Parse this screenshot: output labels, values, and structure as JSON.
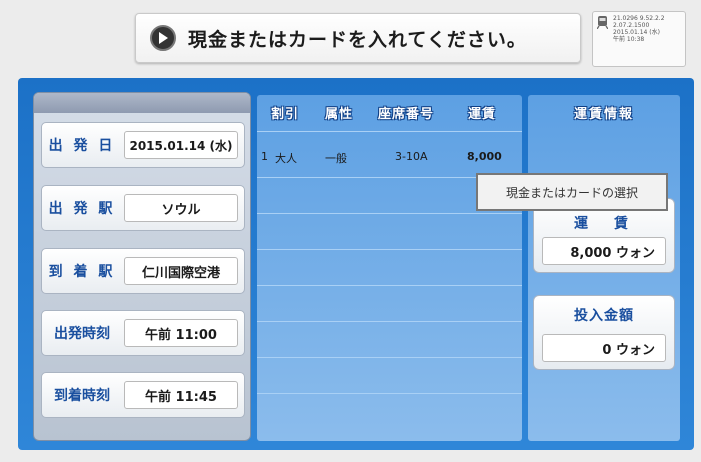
{
  "banner": {
    "text": "現金またはカードを入れてください。"
  },
  "ticket_info": {
    "lines": [
      "21.0296 9.52.2.2",
      "2.07.2.1500",
      "2015.01.14 (水)",
      "午前 10:38"
    ]
  },
  "left": {
    "fields": [
      {
        "label": "出 発 日",
        "value": "2015.01.14 (水)"
      },
      {
        "label": "出 発 駅",
        "value": "ソウル"
      },
      {
        "label": "到 着 駅",
        "value": "仁川国際空港"
      },
      {
        "label": "出発時刻",
        "value": "午前 11:00"
      },
      {
        "label": "到着時刻",
        "value": "午前 11:45"
      }
    ]
  },
  "table": {
    "headers": [
      "割引",
      "属性",
      "座席番号",
      "運賃"
    ],
    "row": {
      "num": "1",
      "discount": "大人",
      "attribute": "一般",
      "seat": "3-10A",
      "fare": "8,000"
    }
  },
  "fare_info": {
    "header": "運賃情報",
    "fare_label": "運　賃",
    "fare_value": "8,000 ウォン",
    "inserted_label": "投入金額",
    "inserted_value": "0 ウォン"
  },
  "tooltip": {
    "text": "現金またはカードの選択"
  }
}
